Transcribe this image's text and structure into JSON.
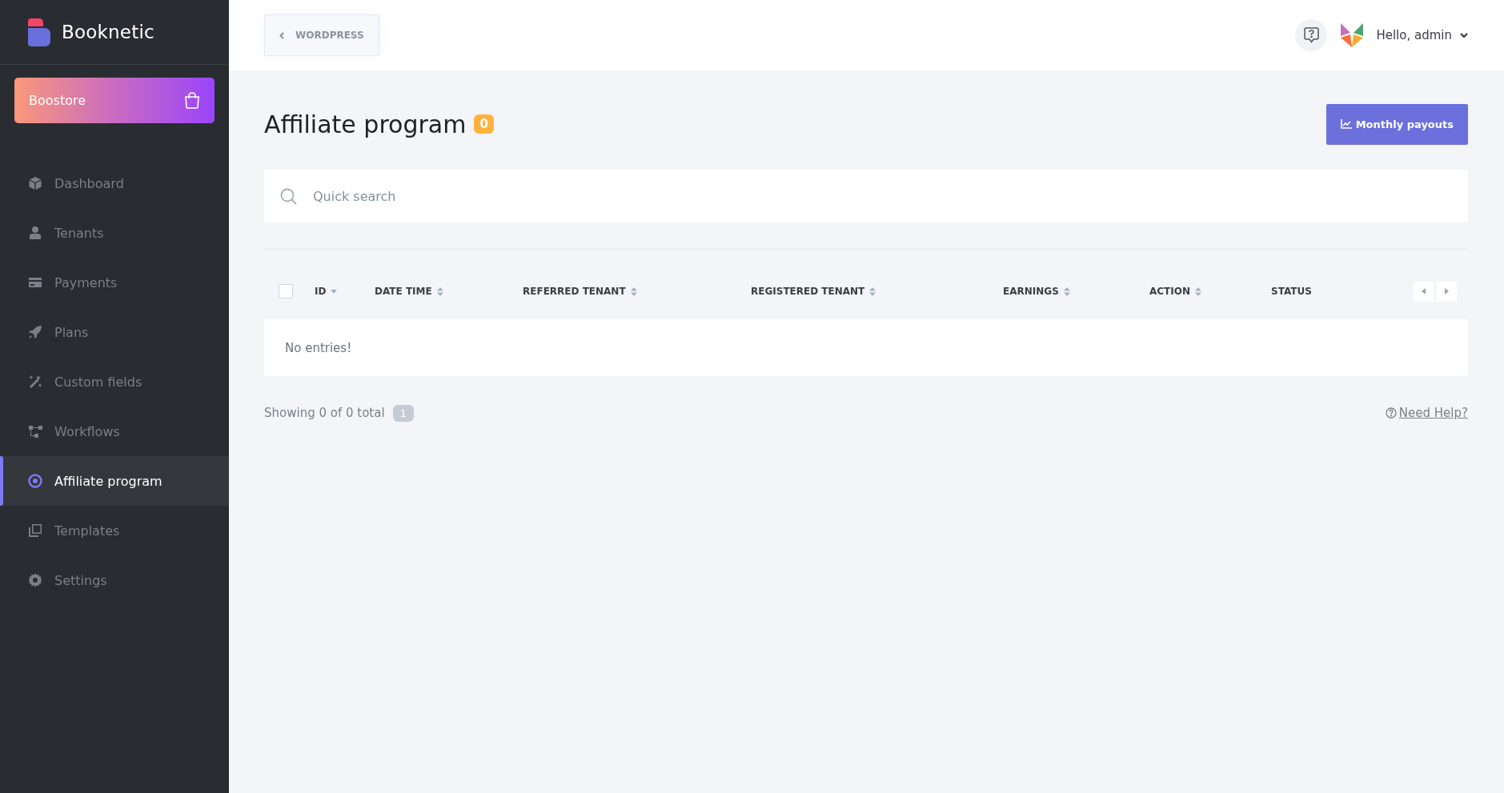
{
  "app": {
    "name": "Booknetic"
  },
  "sidebar": {
    "store_button": {
      "label": "Boostore"
    },
    "items": [
      {
        "label": "Dashboard",
        "selected": false
      },
      {
        "label": "Tenants",
        "selected": false
      },
      {
        "label": "Payments",
        "selected": false
      },
      {
        "label": "Plans",
        "selected": false
      },
      {
        "label": "Custom fields",
        "selected": false
      },
      {
        "label": "Workflows",
        "selected": false
      },
      {
        "label": "Affiliate program",
        "selected": true
      },
      {
        "label": "Templates",
        "selected": false
      },
      {
        "label": "Settings",
        "selected": false
      }
    ]
  },
  "header": {
    "back_button": {
      "label": "WORDPRESS"
    },
    "greeting": "Hello, admin"
  },
  "page": {
    "title": "Affiliate program",
    "count": "0",
    "action_button": {
      "label": "Monthly payouts"
    }
  },
  "search": {
    "placeholder": "Quick search"
  },
  "table": {
    "select_all": {
      "checked": false
    },
    "columns": [
      {
        "label": "ID",
        "sortable": true,
        "sorted": true
      },
      {
        "label": "DATE TIME",
        "sortable": true,
        "sorted": false
      },
      {
        "label": "REFERRED TENANT",
        "sortable": true,
        "sorted": false
      },
      {
        "label": "REGISTERED TENANT",
        "sortable": true,
        "sorted": false
      },
      {
        "label": "EARNINGS",
        "sortable": true,
        "sorted": false
      },
      {
        "label": "ACTION",
        "sortable": true,
        "sorted": false
      },
      {
        "label": "STATUS",
        "sortable": false,
        "sorted": false
      }
    ],
    "empty_message": "No entries!"
  },
  "footer": {
    "summary": "Showing 0 of 0 total",
    "page": "1",
    "help_link": "Need Help?"
  }
}
